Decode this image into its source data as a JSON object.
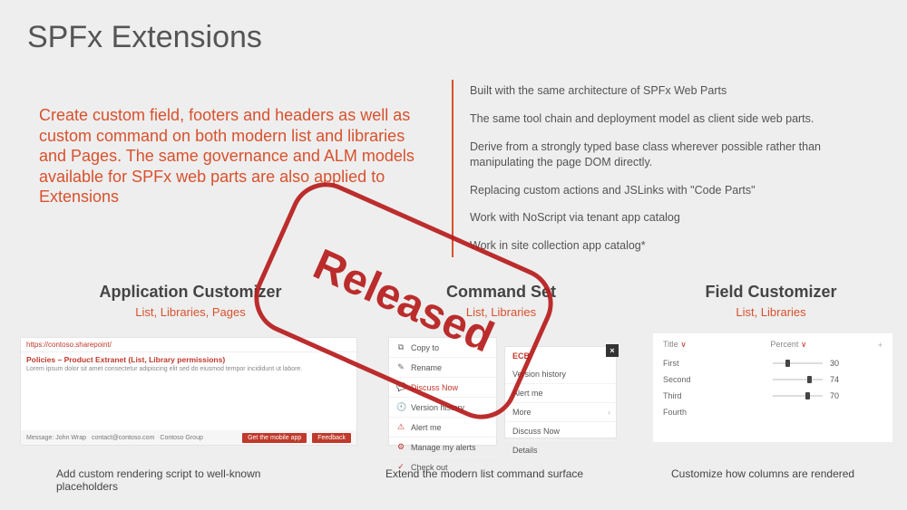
{
  "title": "SPFx Extensions",
  "intro": "Create custom field, footers and headers as well as custom command on both modern list and libraries and Pages. The same governance and ALM models available for SPFx web parts are also applied to Extensions",
  "bullets": [
    "Built with the same architecture of SPFx Web Parts",
    "The same tool chain and deployment model as client side web parts.",
    "Derive from a strongly typed base class wherever possible rather than manipulating the page DOM directly.",
    "Replacing custom actions and JSLinks with \"Code Parts\"",
    "Work with NoScript via tenant app catalog",
    "Work in site collection app catalog*"
  ],
  "cols": {
    "app": {
      "title": "Application Customizer",
      "sub": "List, Libraries, Pages",
      "caption": "Add custom rendering script to well-known placeholders"
    },
    "cmd": {
      "title": "Command Set",
      "sub": "List, Libraries",
      "caption": "Extend the modern list command surface"
    },
    "fld": {
      "title": "Field Customizer",
      "sub": "List, Libraries",
      "caption": "Customize how columns are rendered"
    }
  },
  "app_mini": {
    "addr": "https://contoso.sharepoint/",
    "page_title": "Policies – Product Extranet (List, Library permissions)",
    "footer_left1": "Message: John Wrap",
    "footer_left2": "contact@contoso.com",
    "footer_left3": "Contoso Group",
    "btn1": "Get the mobile app",
    "btn2": "Feedback"
  },
  "cmd_menu": {
    "items": [
      {
        "icon": "📄",
        "label": "Copy to"
      },
      {
        "icon": "✎",
        "label": "Rename"
      },
      {
        "icon": "💬",
        "label": "Discuss Now",
        "red": true
      },
      {
        "icon": "🕘",
        "label": "Version history"
      },
      {
        "icon": "⚠",
        "label": "Alert me"
      },
      {
        "icon": "⚙",
        "label": "Manage my alerts"
      },
      {
        "icon": "✓",
        "label": "Check out"
      }
    ]
  },
  "ecb": {
    "header": "ECB",
    "items": [
      {
        "label": "Version history"
      },
      {
        "label": "Alert me"
      },
      {
        "label": "More",
        "chev": true
      },
      {
        "label": "Discuss Now"
      },
      {
        "label": "Details"
      }
    ]
  },
  "field_table": {
    "col1": "Title",
    "col2": "Percent",
    "rows": [
      {
        "label": "First",
        "value": 30
      },
      {
        "label": "Second",
        "value": 74
      },
      {
        "label": "Third",
        "value": 70
      },
      {
        "label": "Fourth",
        "value": null
      }
    ]
  },
  "stamp": "Released"
}
